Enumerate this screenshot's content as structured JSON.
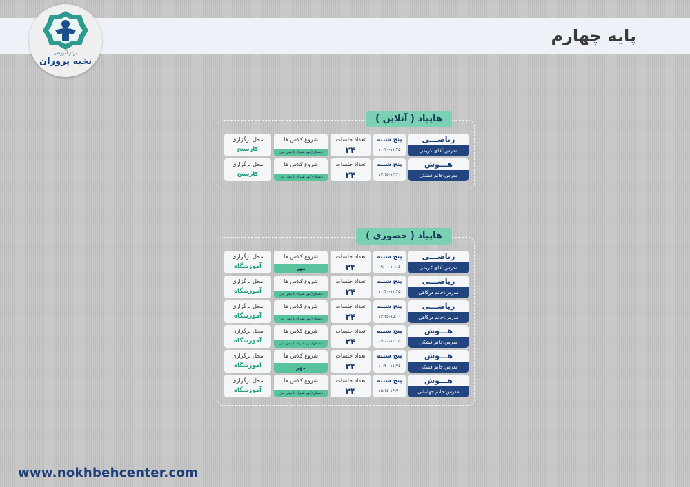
{
  "header": {
    "page_title": "پایه چهارم",
    "logo_subtitle": "مرکز آموزشی",
    "logo_name": "نخبه پروران",
    "website": "www.nokhbehcenter.com"
  },
  "online": {
    "tag": "هاپیاد ( آنلاین )",
    "rows": [
      {
        "course": "ریاضـــی",
        "teacher": "مدرس:آقای کریمی",
        "day": "پنج شنبه",
        "time": "۱۰:۳۰-۱۱:۴۵",
        "count_label": "تعداد جلسات",
        "count": "۲۴",
        "start_label": "شروع کلاس ها",
        "start_note": "تابستان(مهر همراه با پیش نیاز)",
        "place_label": "محل برگزاری",
        "place": "کارسنج"
      },
      {
        "course": "هـــوش",
        "teacher": "مدرس:خانم فشکی",
        "day": "پنج شنبه",
        "time": "۱۲:۱۵-۱۳:۳۰",
        "count_label": "تعداد جلسات",
        "count": "۲۴",
        "start_label": "شروع کلاس ها",
        "start_note": "تابستان(مهر همراه با پیش نیاز)",
        "place_label": "محل برگزاری",
        "place": "کارسنج"
      }
    ]
  },
  "inperson": {
    "tag": "هاپیاد ( حضوری )",
    "rows": [
      {
        "course": "ریاضـــی",
        "teacher": "مدرس:آقای کریمی",
        "day": "پنج شنبه",
        "time": "۰۹:۰۰-۱۰:۱۵",
        "count_label": "تعداد جلسات",
        "count": "۲۴",
        "start_label": "شروع کلاس ها",
        "start_note": "مهر",
        "place_label": "محل برگزاری",
        "place": "آموزشگاه"
      },
      {
        "course": "ریاضـــی",
        "teacher": "مدرس:خانم درگاهی",
        "day": "پنج شنبه",
        "time": "۱۰:۳۰-۱۱:۴۵",
        "count_label": "تعداد جلسات",
        "count": "۲۴",
        "start_label": "شروع کلاس ها",
        "start_note": "تابستان(مهر همراه با پیش نیاز)",
        "place_label": "محل برگزاری",
        "place": "آموزشگاه"
      },
      {
        "course": "ریاضـــی",
        "teacher": "مدرس:خانم درگاهی",
        "day": "پنج شنبه",
        "time": "۱۳:۴۵-۱۵:۰۰",
        "count_label": "تعداد جلسات",
        "count": "۲۴",
        "start_label": "شروع کلاس ها",
        "start_note": "تابستان(مهر همراه با پیش نیاز)",
        "place_label": "محل برگزاری",
        "place": "آموزشگاه"
      },
      {
        "course": "هـــوش",
        "teacher": "مدرس:خانم فشکی",
        "day": "پنج شنبه",
        "time": "۰۹:۰۰-۱۰:۱۵",
        "count_label": "تعداد جلسات",
        "count": "۲۴",
        "start_label": "شروع کلاس ها",
        "start_note": "تابستان(مهر همراه با پیش نیاز)",
        "place_label": "محل برگزاری",
        "place": "آموزشگاه"
      },
      {
        "course": "هـــوش",
        "teacher": "مدرس:خانم فشکی",
        "day": "پنج شنبه",
        "time": "۱۰:۳۰-۱۱:۴۵",
        "count_label": "تعداد جلسات",
        "count": "۲۴",
        "start_label": "شروع کلاس ها",
        "start_note": "مهر",
        "place_label": "محل برگزاری",
        "place": "آموزشگاه"
      },
      {
        "course": "هـــوش",
        "teacher": "مدرس:خانم جهانبانی",
        "day": "پنج شنبه",
        "time": "۱۵:۱۵-۱۶:۳۰",
        "count_label": "تعداد جلسات",
        "count": "۲۴",
        "start_label": "شروع کلاس ها",
        "start_note": "تابستان(مهر همراه با پیش نیاز)",
        "place_label": "محل برگزاری",
        "place": "آموزشگاه"
      }
    ]
  }
}
